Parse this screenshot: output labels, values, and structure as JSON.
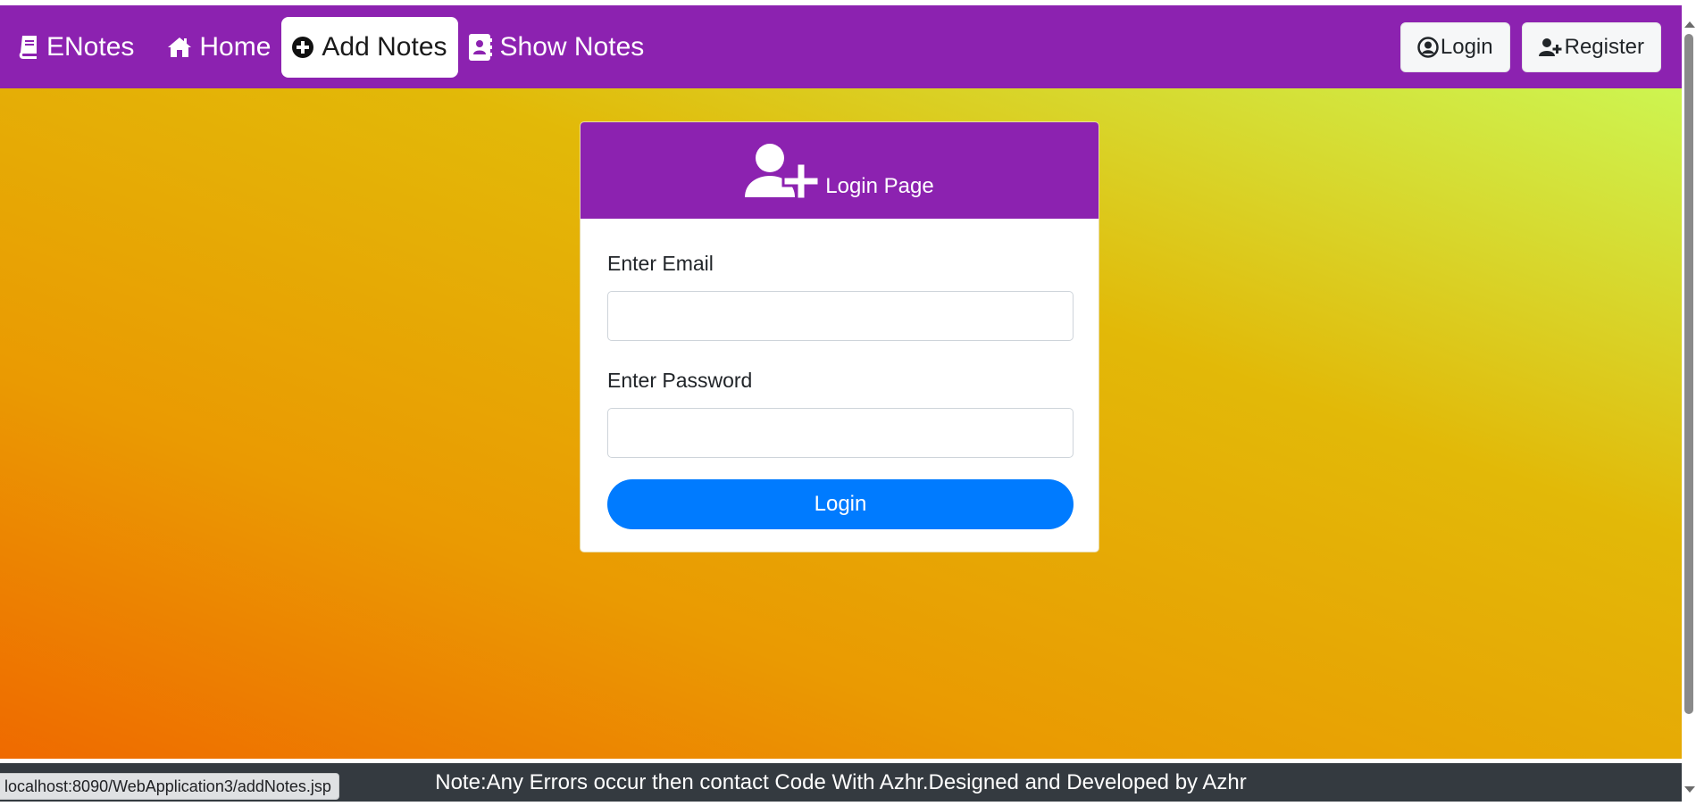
{
  "navbar": {
    "brand": "ENotes",
    "links": [
      {
        "label": "Home",
        "icon": "home-icon"
      },
      {
        "label": "Add Notes",
        "icon": "plus-circle-icon",
        "active": true
      },
      {
        "label": "Show Notes",
        "icon": "address-book-icon"
      }
    ],
    "login_label": "Login",
    "register_label": "Register"
  },
  "card": {
    "title": "Login Page",
    "email_label": "Enter Email",
    "email_value": "",
    "password_label": "Enter Password",
    "password_value": "",
    "submit_label": "Login"
  },
  "footer": {
    "text": "Note:Any Errors occur then contact Code With Azhr.Designed and Developed by Azhr"
  },
  "status_bar": {
    "url": "localhost:8090/WebApplication3/addNotes.jsp"
  },
  "colors": {
    "nav_bg": "#8c22b0",
    "primary_button": "#007bff",
    "footer_bg": "#343a40"
  }
}
